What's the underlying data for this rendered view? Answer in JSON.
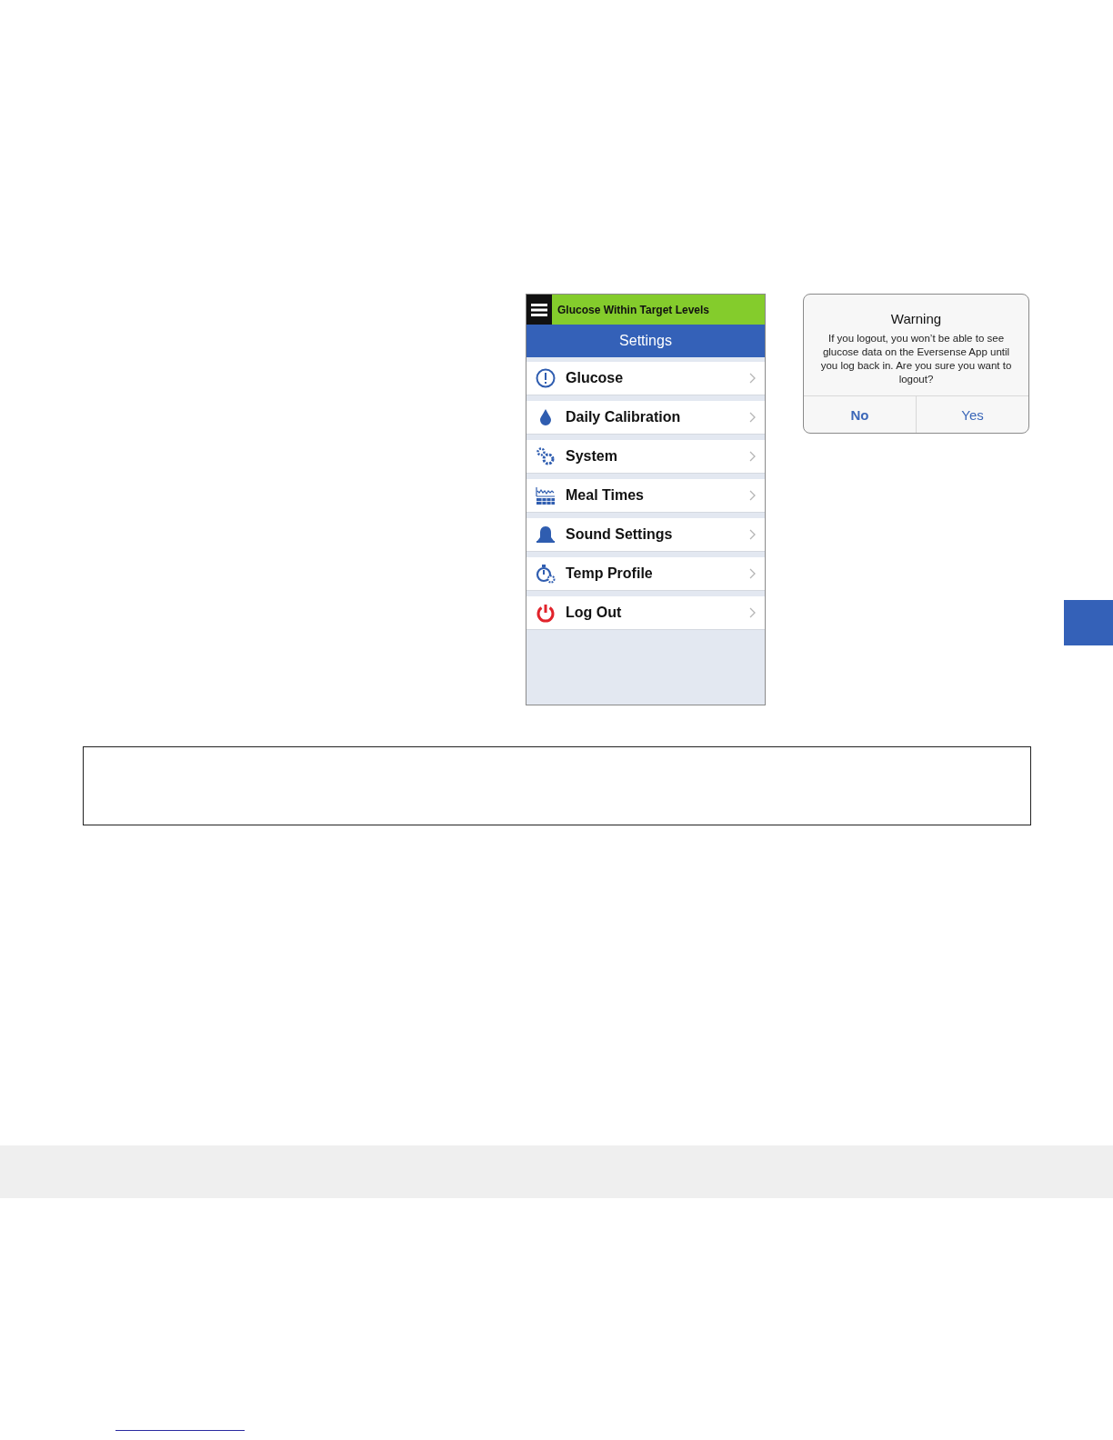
{
  "phone": {
    "status_banner": "Glucose Within Target Levels",
    "title": "Settings",
    "menu_items": [
      {
        "label": "Glucose"
      },
      {
        "label": "Daily Calibration"
      },
      {
        "label": "System"
      },
      {
        "label": "Meal Times"
      },
      {
        "label": "Sound Settings"
      },
      {
        "label": "Temp Profile"
      },
      {
        "label": "Log Out"
      }
    ]
  },
  "dialog": {
    "title": "Warning",
    "message": "If you logout, you won’t be able to see glucose data on the Eversense App until you log back in. Are you sure you want to logout?",
    "buttons": [
      {
        "label": "No",
        "bold": true
      },
      {
        "label": "Yes",
        "bold": false
      }
    ]
  }
}
